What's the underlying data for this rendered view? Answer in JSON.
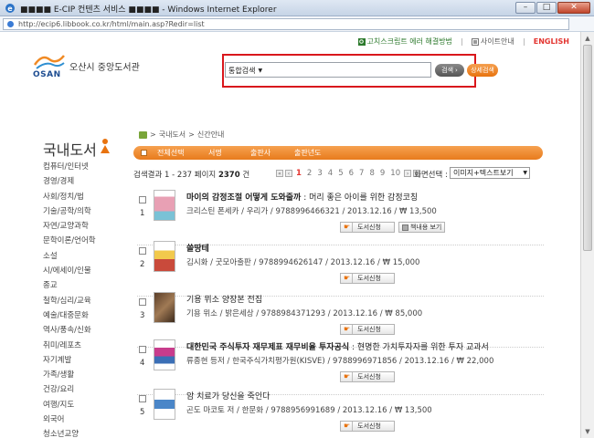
{
  "window": {
    "title": "■■■■ E-CIP 컨텐츠 서비스 ■■■■ - Windows Internet Explorer",
    "url": "http://ecip6.libbook.co.kr/html/main.asp?Redir=list"
  },
  "util": {
    "help": "고치스크립트 에러 해결방법",
    "sitemap": "사이트안내",
    "english": "ENGLISH"
  },
  "library": {
    "name": "오산시 중앙도서관",
    "logo_text": "OSAN"
  },
  "search": {
    "type": "통합검색",
    "button": "검색",
    "detail_button": "상세검색"
  },
  "sidebar": {
    "title": "국내도서",
    "items": [
      "컴퓨터/인터넷",
      "경영/경제",
      "사회/정치/법",
      "기술/공학/의학",
      "자연/교양과학",
      "문학이론/언어학",
      "소설",
      "시/에세이/인물",
      "종교",
      "철학/심리/교육",
      "예술/대중문화",
      "역사/풍속/신화",
      "취미/레포츠",
      "자기계발",
      "가족/생활",
      "건강/요리",
      "여행/지도",
      "외국어",
      "청소년교양"
    ]
  },
  "breadcrumb": {
    "items": [
      "국내도서",
      "신간안내"
    ]
  },
  "sortbar": {
    "tabs": [
      "전체선택",
      "서명",
      "출판사",
      "출판년도"
    ]
  },
  "results": {
    "prefix": "검색결과 1 - 237 페이지",
    "count": "2370",
    "unit": "건"
  },
  "pager": {
    "pages": [
      "1",
      "2",
      "3",
      "4",
      "5",
      "6",
      "7",
      "8",
      "9",
      "10"
    ],
    "current": "1"
  },
  "view": {
    "label": "화면선택 :",
    "value": "이미지+텍스트보기"
  },
  "books": [
    {
      "index": "1",
      "title_bold": "마이의 감정조절 어떻게 도와줄까",
      "title_rest": " : 머리 좋은 아이를 위한 감정코칭",
      "meta": "크리스틴 폰세카 / 우리가 / 9788996466321 / 2013.12.16 / ₩ 13,500",
      "request": "도서신청",
      "preview": "책내용 보기",
      "cover_color": "#e8a0b4"
    },
    {
      "index": "2",
      "title_bold": "쓸땅테",
      "title_rest": "",
      "meta": "김시화 / 굿모아출판 / 9788994626147 / 2013.12.16 / ₩ 15,000",
      "request": "도서신청",
      "cover_color": "#f2c94c"
    },
    {
      "index": "3",
      "title_bold": "",
      "title_rest": "기용 뮈소 양장본 전집",
      "meta": "기용 뮈소 / 밝은세상 / 9788984371293 / 2013.12.16 / ₩ 85,000",
      "request": "도서신청",
      "cover_color": "#8b6b4a"
    },
    {
      "index": "4",
      "title_bold": "대한민국 주식투자 재무제표 재무비율 투자공식",
      "title_rest": " : 현명한 가치투자자를 위한 투자 교과서",
      "meta": "류종현 등저 / 한국주식가치평가원(KISVE) / 9788996971856 / 2013.12.16 / ₩ 22,000",
      "request": "도서신청",
      "cover_color": "#c83c8c"
    },
    {
      "index": "5",
      "title_bold": "",
      "title_rest": "암 치료가 당신을 죽인다",
      "meta": "곤도 마코토 저 / 한문화 / 9788956991689 / 2013.12.16 / ₩ 13,500",
      "request": "도서신청",
      "cover_color": "#4a86c8"
    }
  ]
}
